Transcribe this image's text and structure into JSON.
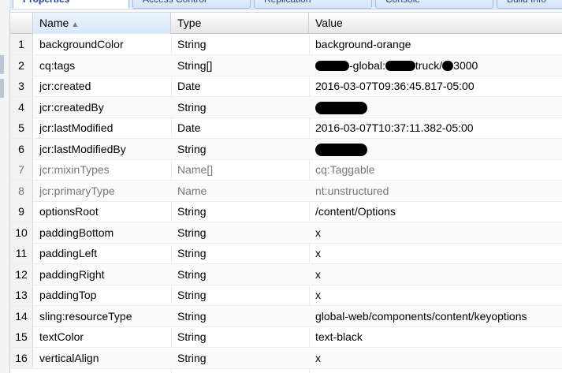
{
  "tabs": [
    {
      "label": "Properties",
      "active": true
    },
    {
      "label": "Access Control",
      "active": false
    },
    {
      "label": "Replication",
      "active": false
    },
    {
      "label": "Console",
      "active": false
    },
    {
      "label": "Build Info",
      "active": false
    }
  ],
  "columns": {
    "name": "Name",
    "type": "Type",
    "value": "Value",
    "sort_icon": "sort-ascending-icon"
  },
  "rows": [
    {
      "num": "1",
      "name": "backgroundColor",
      "type": "String",
      "value": "background-orange",
      "muted": false
    },
    {
      "num": "2",
      "name": "cq:tags",
      "type": "String[]",
      "value": "",
      "redacted": "tags",
      "parts": [
        "-global:",
        "truck/",
        "3000"
      ],
      "muted": false
    },
    {
      "num": "3",
      "name": "jcr:created",
      "type": "Date",
      "value": "2016-03-07T09:36:45.817-05:00",
      "muted": false
    },
    {
      "num": "4",
      "name": "jcr:createdBy",
      "type": "String",
      "value": "",
      "redacted": "full",
      "muted": false
    },
    {
      "num": "5",
      "name": "jcr:lastModified",
      "type": "Date",
      "value": "2016-03-07T10:37:11.382-05:00",
      "muted": false
    },
    {
      "num": "6",
      "name": "jcr:lastModifiedBy",
      "type": "String",
      "value": "",
      "redacted": "full",
      "muted": false
    },
    {
      "num": "7",
      "name": "jcr:mixinTypes",
      "type": "Name[]",
      "value": "cq:Taggable",
      "muted": true
    },
    {
      "num": "8",
      "name": "jcr:primaryType",
      "type": "Name",
      "value": "nt:unstructured",
      "muted": true
    },
    {
      "num": "9",
      "name": "optionsRoot",
      "type": "String",
      "value": "/content/Options",
      "muted": false
    },
    {
      "num": "10",
      "name": "paddingBottom",
      "type": "String",
      "value": "x",
      "muted": false
    },
    {
      "num": "11",
      "name": "paddingLeft",
      "type": "String",
      "value": "x",
      "muted": false
    },
    {
      "num": "12",
      "name": "paddingRight",
      "type": "String",
      "value": "x",
      "muted": false
    },
    {
      "num": "13",
      "name": "paddingTop",
      "type": "String",
      "value": "x",
      "muted": false
    },
    {
      "num": "14",
      "name": "sling:resourceType",
      "type": "String",
      "value": "global-web/components/content/keyoptions",
      "muted": false
    },
    {
      "num": "15",
      "name": "textColor",
      "type": "String",
      "value": "text-black",
      "muted": false
    },
    {
      "num": "16",
      "name": "verticalAlign",
      "type": "String",
      "value": "x",
      "muted": false
    }
  ]
}
